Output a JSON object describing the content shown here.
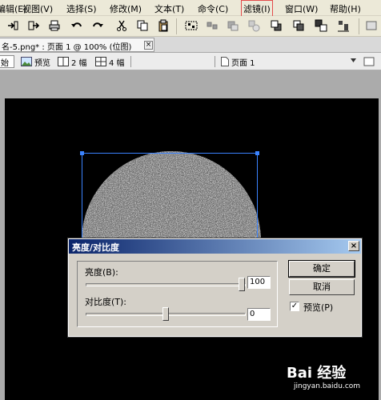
{
  "menu": [
    {
      "label": "编辑(E)"
    },
    {
      "label": "视图(V)"
    },
    {
      "label": "选择(S)"
    },
    {
      "label": "修改(M)"
    },
    {
      "label": "文本(T)"
    },
    {
      "label": "命令(C)"
    },
    {
      "label": "滤镜(I)",
      "highlighted": true
    },
    {
      "label": "窗口(W)"
    },
    {
      "label": "帮助(H)"
    }
  ],
  "toolbar": {
    "icons": [
      "import-icon",
      "export-icon",
      "print-icon",
      "undo-icon",
      "redo-icon",
      "cut-icon",
      "copy-icon",
      "paste-icon",
      "group-icon",
      "ungroup-icon",
      "join-icon",
      "split-icon",
      "bring-forward-icon",
      "send-backward-icon",
      "send-to-back-icon",
      "align-icon"
    ]
  },
  "document_tab": {
    "title": "名-5.png* : 页面 1 @ 100% (位图)",
    "close_symbol": "×"
  },
  "view_bar": {
    "original_label": "始",
    "preview_label": "预览",
    "two_up_label": "2 幅",
    "four_up_label": "4 幅",
    "page_label": "页面 1"
  },
  "dialog": {
    "title": "亮度/对比度",
    "close_symbol": "×",
    "brightness_label": "亮度(B):",
    "brightness_value": "100",
    "brightness_level": 100,
    "contrast_label": "对比度(T):",
    "contrast_value": "0",
    "contrast_level": 0,
    "ok_label": "确定",
    "cancel_label": "取消",
    "preview_label": "预览(P)",
    "preview_checked": "✓"
  },
  "watermark": {
    "brand": "Bai 经验",
    "url": "jingyan.baidu.com"
  }
}
